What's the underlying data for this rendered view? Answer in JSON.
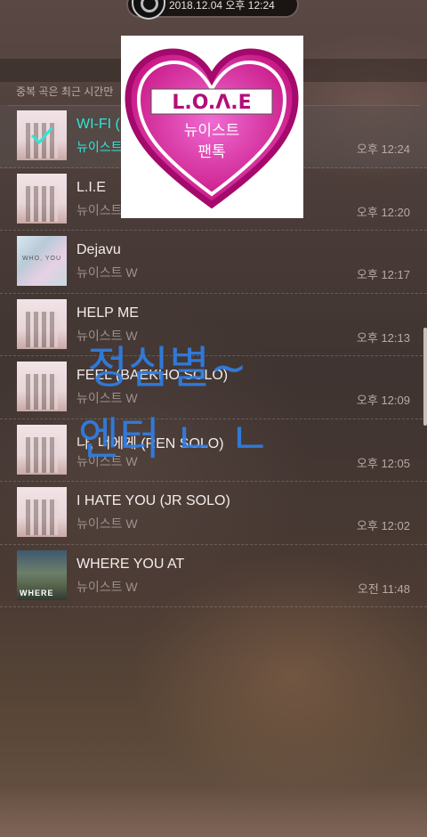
{
  "status": {
    "datetime": "2018.12.04 오후 12:24"
  },
  "notice": "중복 곡은 최근 시간만",
  "tracks": [
    {
      "title": "WI-FI (",
      "artist": "뉴이스트",
      "time": "오후 12:24",
      "selected": true
    },
    {
      "title": "L.I.E",
      "artist": "뉴이스트 W",
      "time": "오후 12:20"
    },
    {
      "title": "Dejavu",
      "artist": "뉴이스트 W",
      "time": "오후 12:17"
    },
    {
      "title": "HELP ME",
      "artist": "뉴이스트 W",
      "time": "오후 12:13"
    },
    {
      "title": "FEEL (BAEKHO SOLO)",
      "artist": "뉴이스트 W",
      "time": "오후 12:09"
    },
    {
      "title": "나, 너에게 (REN SOLO)",
      "artist": "뉴이스트 W",
      "time": "오후 12:05"
    },
    {
      "title": "I HATE YOU (JR SOLO)",
      "artist": "뉴이스트 W",
      "time": "오후 12:02"
    },
    {
      "title": "WHERE YOU AT",
      "artist": "뉴이스트 W",
      "time": "오전 11:48"
    }
  ],
  "album_labels": {
    "dejavu": "WHO, YOU",
    "where": "WHERE"
  },
  "overlay": {
    "logo_text": "L.O.Λ.E",
    "logo_sub1": "뉴이스트",
    "logo_sub2": "팬톡",
    "handwriting_line1": "정심별~",
    "handwriting_line2": "엔터 ㄴ ㄴ",
    "colors": {
      "heart": "#e0148c",
      "handwriting": "#2f7fe6",
      "accent": "#2ee6d6"
    }
  }
}
